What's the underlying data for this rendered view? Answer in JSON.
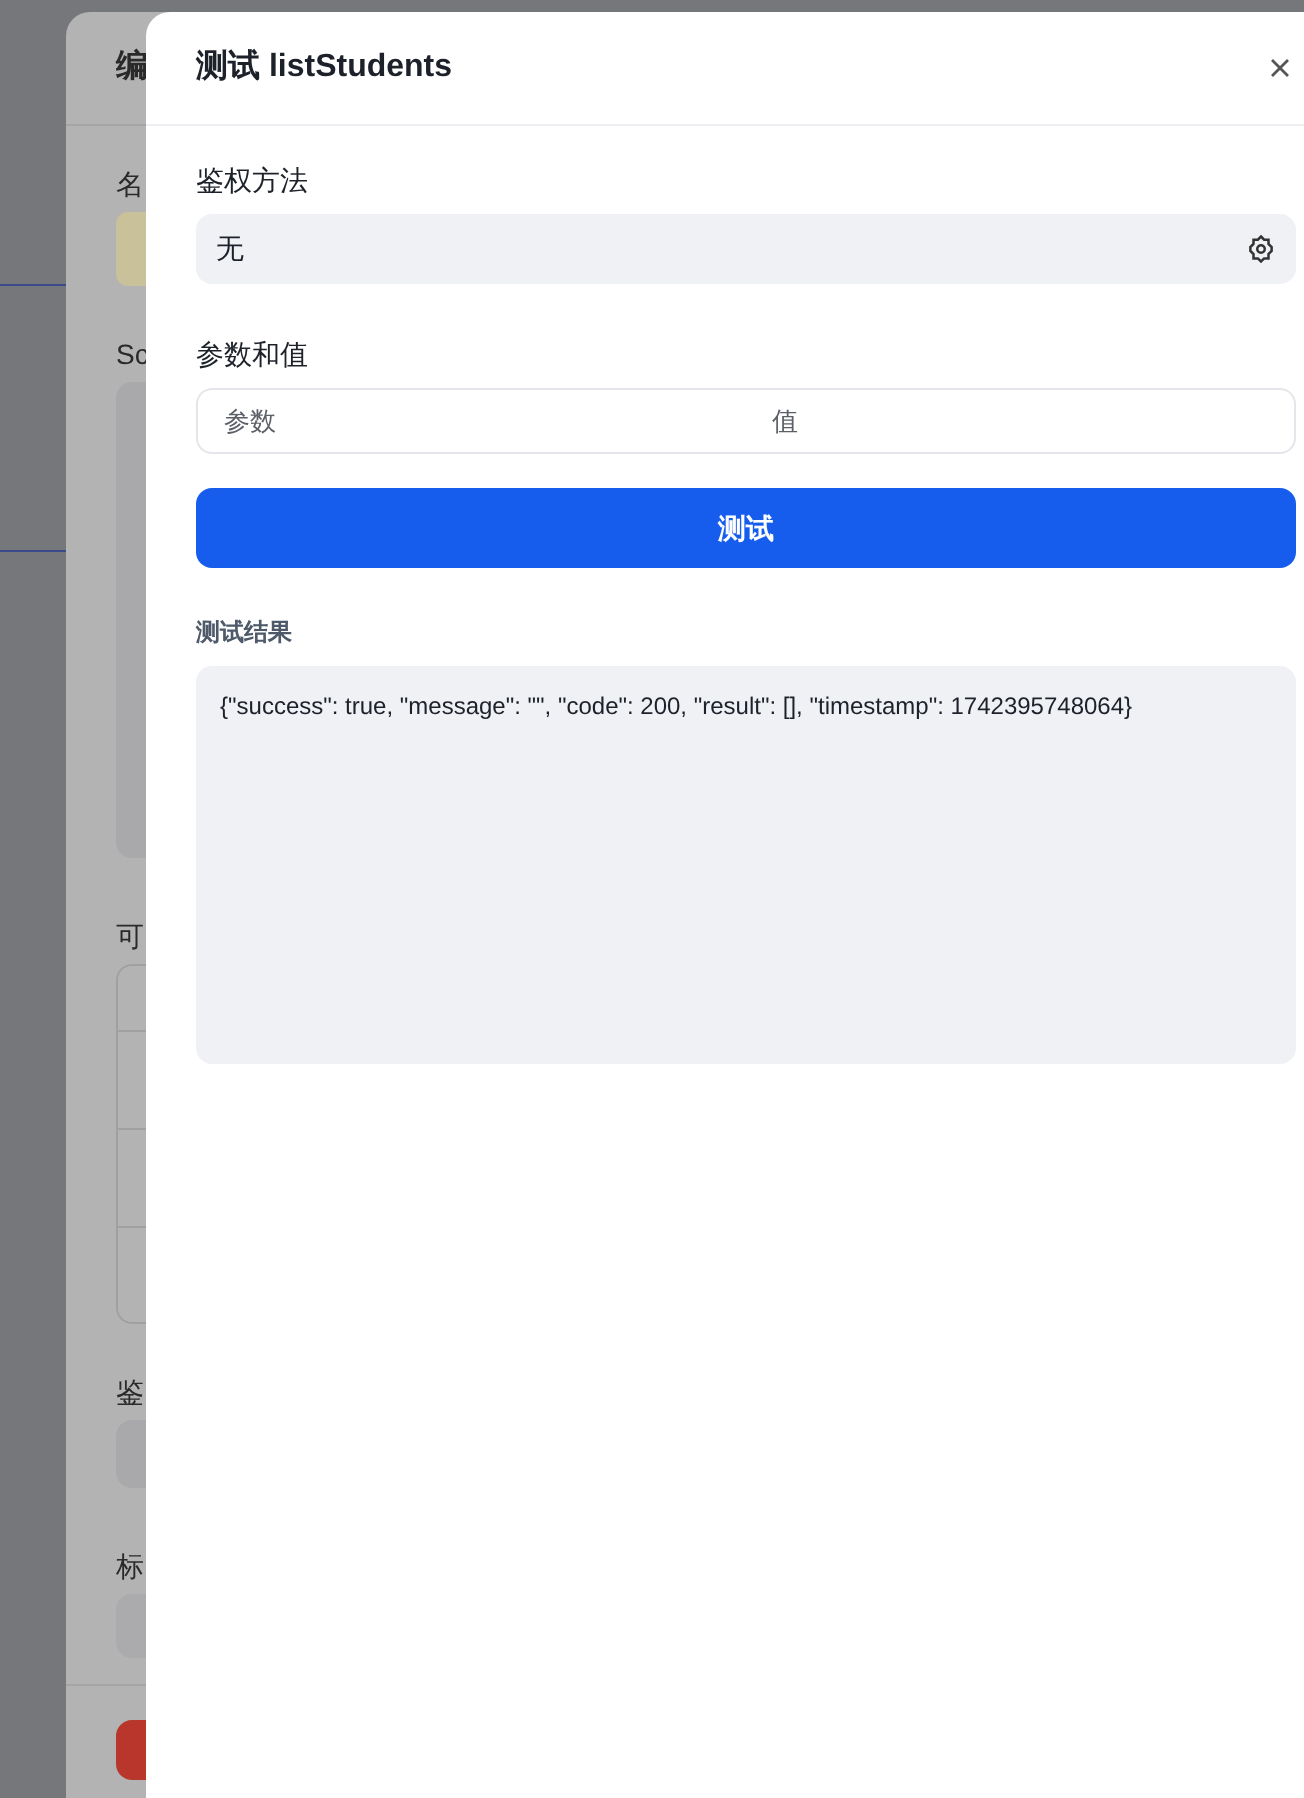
{
  "background_drawer": {
    "title": "编",
    "labels": [
      "名",
      "Sc",
      "可",
      "鉴",
      "标"
    ]
  },
  "test_panel": {
    "title": "测试 listStudents",
    "auth": {
      "label": "鉴权方法",
      "value": "无"
    },
    "params": {
      "label": "参数和值",
      "columns": [
        {
          "placeholder": "参数"
        },
        {
          "placeholder": "值"
        }
      ]
    },
    "test_button": "测试",
    "result": {
      "label": "测试结果",
      "text": "{\"success\": true, \"message\": \"\", \"code\": 200, \"result\": [], \"timestamp\": 1742395748064}"
    }
  }
}
